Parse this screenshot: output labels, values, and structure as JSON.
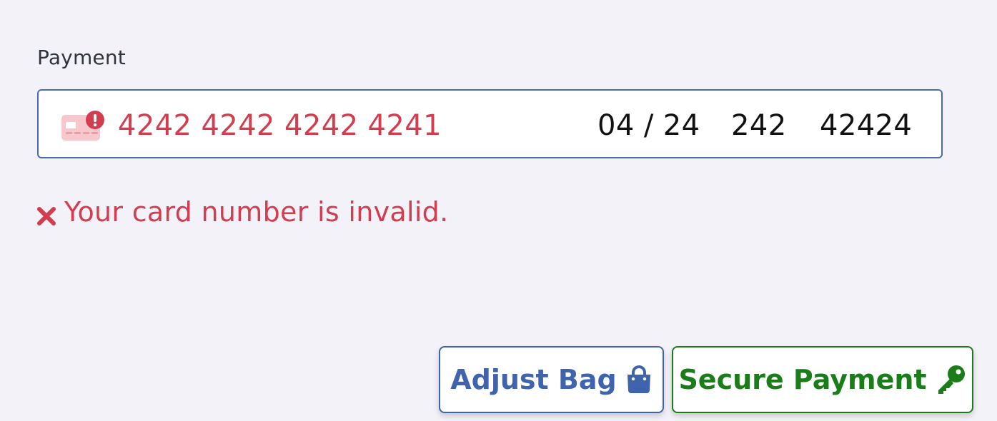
{
  "payment": {
    "label": "Payment",
    "card_number": "4242 4242 4242 4241",
    "expiry": "04 / 24",
    "cvc": "242",
    "zip": "42424",
    "card_icon": "card-error-icon"
  },
  "error": {
    "message": "Your card number is invalid.",
    "icon": "x-icon"
  },
  "buttons": {
    "adjust_label": "Adjust Bag",
    "adjust_icon": "shopping-bag-icon",
    "secure_label": "Secure Payment",
    "secure_icon": "key-icon"
  },
  "colors": {
    "error": "#d23d4f",
    "field_border": "#4a6bb0",
    "adjust_button": "#3f64ad",
    "secure_button": "#1a7d1a",
    "background": "#f3f2f8"
  }
}
